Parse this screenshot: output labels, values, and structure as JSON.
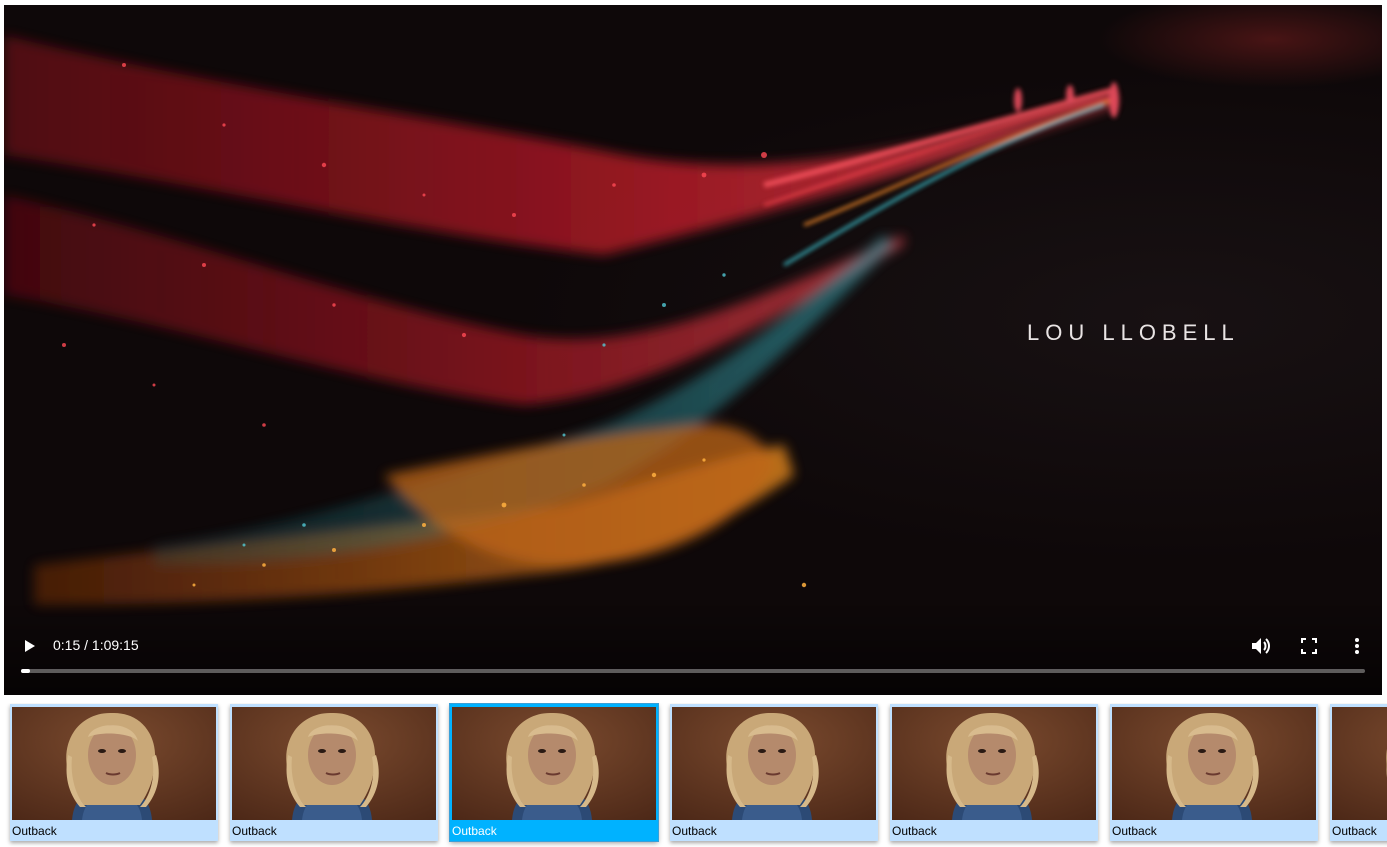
{
  "player": {
    "title_overlay": "LOU LLOBELL",
    "time_display": "0:15 / 1:09:15",
    "progress_fraction": 0.007,
    "icons": {
      "play": "play-icon",
      "volume": "volume-icon",
      "fullscreen": "fullscreen-icon",
      "more": "more-vert-icon"
    }
  },
  "playlist": {
    "items": [
      {
        "label": "Outback",
        "active": false
      },
      {
        "label": "Outback",
        "active": false
      },
      {
        "label": "Outback",
        "active": true
      },
      {
        "label": "Outback",
        "active": false
      },
      {
        "label": "Outback",
        "active": false
      },
      {
        "label": "Outback",
        "active": false
      },
      {
        "label": "Outback",
        "active": false
      }
    ],
    "active_color": "#00b2ff",
    "inactive_color": "#bfe0ff"
  }
}
